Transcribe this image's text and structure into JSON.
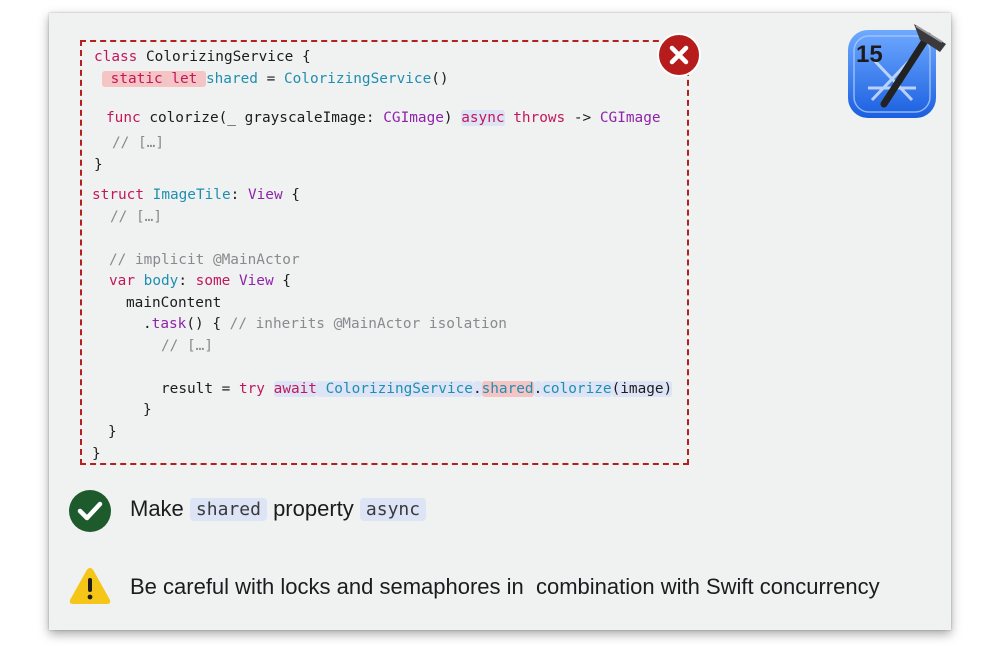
{
  "code": {
    "lines": [
      [
        [
          "kw",
          "class"
        ],
        [
          "pl",
          " ColorizingService {"
        ]
      ],
      [
        [
          "kw hl-red",
          " static let "
        ],
        [
          "fn",
          "shared"
        ],
        [
          "pl",
          " = "
        ],
        [
          "fn",
          "ColorizingService"
        ],
        [
          "pl",
          "()"
        ]
      ],
      [
        [
          "kw",
          "func"
        ],
        [
          "pl",
          " colorize(_ grayscaleImage: "
        ],
        [
          "ty",
          "CGImage"
        ],
        [
          "pl",
          ") "
        ],
        [
          "kw hl-blue",
          "async"
        ],
        [
          "pl",
          " "
        ],
        [
          "kw",
          "throws"
        ],
        [
          "pl",
          " -> "
        ],
        [
          "ty",
          "CGImage"
        ]
      ],
      [
        [
          "cm",
          "// […]"
        ]
      ],
      [
        [
          "pl",
          "}"
        ]
      ],
      [
        [
          "kw",
          "struct"
        ],
        [
          "pl",
          " "
        ],
        [
          "fn",
          "ImageTile"
        ],
        [
          "pl",
          ": "
        ],
        [
          "ty",
          "View"
        ],
        [
          "pl",
          " {"
        ]
      ],
      [
        [
          "cm",
          "// […]"
        ]
      ],
      [
        [
          "cm",
          "// implicit @MainActor"
        ]
      ],
      [
        [
          "kw",
          "var"
        ],
        [
          "pl",
          " "
        ],
        [
          "fn",
          "body"
        ],
        [
          "pl",
          ": "
        ],
        [
          "kw",
          "some"
        ],
        [
          "pl",
          " "
        ],
        [
          "ty",
          "View"
        ],
        [
          "pl",
          " {"
        ]
      ],
      [
        [
          "pl",
          "mainContent"
        ]
      ],
      [
        [
          "pl",
          "."
        ],
        [
          "ty",
          "task"
        ],
        [
          "pl",
          "() { "
        ],
        [
          "cm",
          "// inherits @MainActor isolation"
        ]
      ],
      [
        [
          "cm",
          "// […]"
        ]
      ],
      [
        [
          "pl",
          "result = "
        ],
        [
          "kw",
          "try"
        ],
        [
          "pl",
          " "
        ],
        [
          "kw hl-blue",
          "await"
        ],
        [
          "fn hl-blue",
          " ColorizingService"
        ],
        [
          "pl hl-blue",
          "."
        ],
        [
          "fn hl-red",
          "shared"
        ],
        [
          "pl hl-blue",
          "."
        ],
        [
          "fn hl-blue",
          "colorize"
        ],
        [
          "pl hl-blue",
          "(image)"
        ]
      ],
      [
        [
          "pl",
          "}"
        ]
      ],
      [
        [
          "pl",
          "}"
        ]
      ],
      [
        [
          "pl",
          "}"
        ]
      ]
    ]
  },
  "xcode_badge_text": "15",
  "solution": {
    "prefix": "Make ",
    "chip1": "shared",
    "middle": " property ",
    "chip2": "async"
  },
  "warning": {
    "text": "Be careful with locks and semaphores in  combination with Swift concurrency"
  },
  "colors": {
    "error_red": "#b71c1c",
    "success_green": "#1e5b2c",
    "warning_yellow": "#f5c518",
    "keyword": "#c2185b",
    "type": "#8e24aa",
    "function": "#1f8fb0"
  }
}
